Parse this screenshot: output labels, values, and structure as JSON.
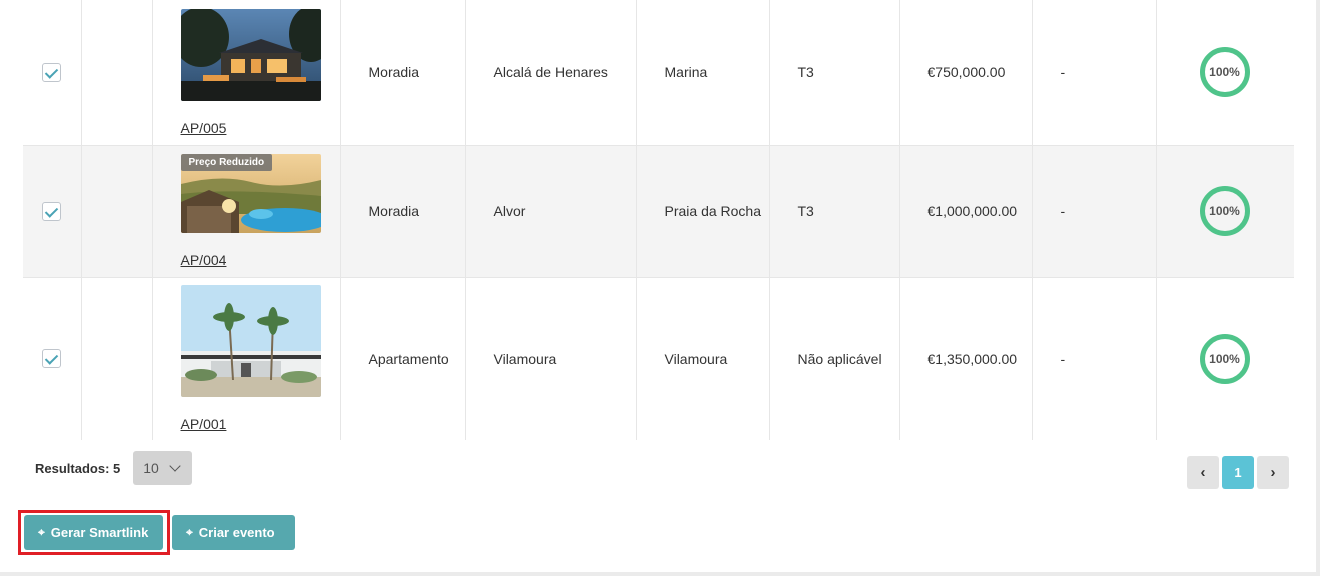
{
  "rows": [
    {
      "ref": "AP/005",
      "badge": "",
      "type": "Moradia",
      "municipality": "Alcalá de Henares",
      "zone": "Marina",
      "typology": "T3",
      "price": "€750,000.00",
      "extra": "-",
      "completion": "100%",
      "checked": true
    },
    {
      "ref": "AP/004",
      "badge": "Preço Reduzido",
      "type": "Moradia",
      "municipality": "Alvor",
      "zone": "Praia da Rocha",
      "typology": "T3",
      "price": "€1,000,000.00",
      "extra": "-",
      "completion": "100%",
      "checked": true
    },
    {
      "ref": "AP/001",
      "badge": "",
      "type": "Apartamento",
      "municipality": "Vilamoura",
      "zone": "Vilamoura",
      "typology": "Não aplicável",
      "price": "€1,350,000.00",
      "extra": "-",
      "completion": "100%",
      "checked": true
    }
  ],
  "footer": {
    "results_label": "Resultados: 5",
    "page_size": "10",
    "prev": "‹",
    "current_page": "1",
    "next": "›"
  },
  "actions": {
    "smartlink_label": "Gerar Smartlink",
    "event_label": "Criar evento",
    "icon": "crosshair-icon"
  },
  "colors": {
    "accent": "#56a8ae",
    "completion_ring": "#4fc48a",
    "page_active": "#5bc3d6",
    "highlight": "#e01f26"
  }
}
